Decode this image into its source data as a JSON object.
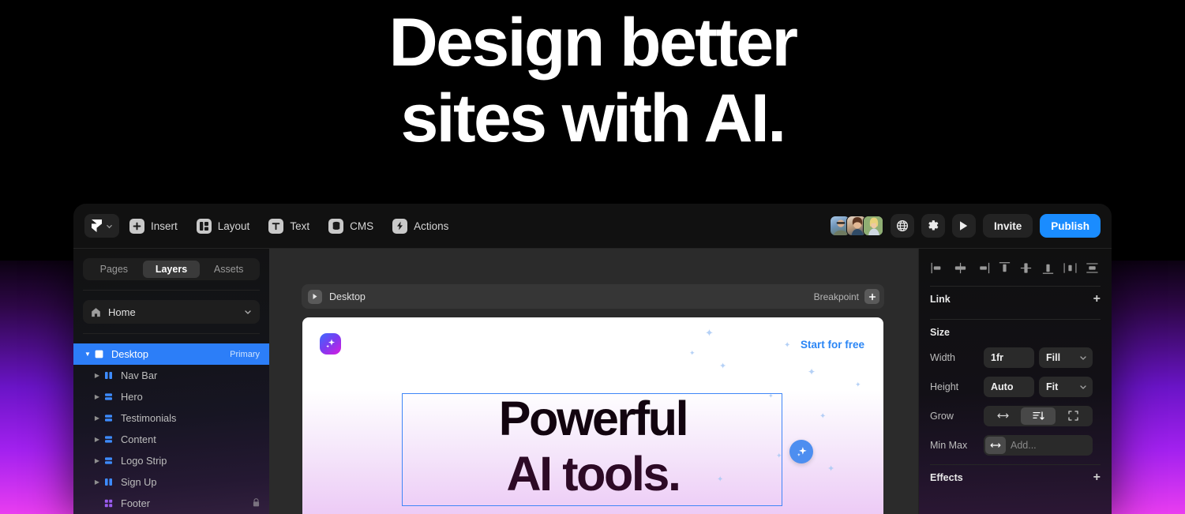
{
  "hero": {
    "line1": "Design better",
    "line2": "sites with AI."
  },
  "toolbar": {
    "logo_icon": "framer-logo-icon",
    "logo_chevron_icon": "chevron-down-icon",
    "items": [
      {
        "label": "Insert",
        "icon": "plus-square-icon"
      },
      {
        "label": "Layout",
        "icon": "layout-columns-icon"
      },
      {
        "label": "Text",
        "icon": "text-t-icon"
      },
      {
        "label": "CMS",
        "icon": "database-icon"
      },
      {
        "label": "Actions",
        "icon": "lightning-bolt-icon"
      }
    ],
    "avatars": [
      "avatar-1",
      "avatar-2",
      "avatar-3"
    ],
    "globe_icon": "globe-icon",
    "settings_icon": "gear-icon",
    "preview_icon": "play-icon",
    "invite_label": "Invite",
    "publish_label": "Publish",
    "publish_color": "#1a8cff"
  },
  "left_panel": {
    "tabs": [
      {
        "label": "Pages",
        "active": false
      },
      {
        "label": "Layers",
        "active": true
      },
      {
        "label": "Assets",
        "active": false
      }
    ],
    "page_selector": {
      "icon": "home-icon",
      "label": "Home",
      "chevron_icon": "chevron-down-icon"
    },
    "layers": [
      {
        "name": "Desktop",
        "icon": "frame-icon",
        "badge": "Primary",
        "selected": true,
        "expanded": true,
        "indent": 0,
        "locked": false,
        "icon_color": "#ffffff"
      },
      {
        "name": "Nav Bar",
        "icon": "stack-vertical-icon",
        "badge": "",
        "selected": false,
        "expanded": false,
        "indent": 1,
        "locked": false,
        "icon_color": "#3d8bfd"
      },
      {
        "name": "Hero",
        "icon": "stack-horizontal-icon",
        "badge": "",
        "selected": false,
        "expanded": false,
        "indent": 1,
        "locked": false,
        "icon_color": "#3d8bfd"
      },
      {
        "name": "Testimonials",
        "icon": "stack-horizontal-icon",
        "badge": "",
        "selected": false,
        "expanded": false,
        "indent": 1,
        "locked": false,
        "icon_color": "#3d8bfd"
      },
      {
        "name": "Content",
        "icon": "stack-horizontal-icon",
        "badge": "",
        "selected": false,
        "expanded": false,
        "indent": 1,
        "locked": false,
        "icon_color": "#3d8bfd"
      },
      {
        "name": "Logo Strip",
        "icon": "stack-horizontal-icon",
        "badge": "",
        "selected": false,
        "expanded": false,
        "indent": 1,
        "locked": false,
        "icon_color": "#3d8bfd"
      },
      {
        "name": "Sign Up",
        "icon": "stack-vertical-icon",
        "badge": "",
        "selected": false,
        "expanded": false,
        "indent": 1,
        "locked": false,
        "icon_color": "#3d8bfd"
      },
      {
        "name": "Footer",
        "icon": "grid-four-icon",
        "badge": "",
        "selected": false,
        "expanded": false,
        "indent": 1,
        "locked": true,
        "icon_color": "#9b5cf0"
      }
    ],
    "selected_color": "#2c7ef8"
  },
  "canvas": {
    "breakpoint_bar": {
      "play_icon": "play-icon",
      "label": "Desktop",
      "breakpoint_label": "Breakpoint",
      "add_icon": "plus-icon"
    },
    "artboard": {
      "ai_badge_icon": "sparkle-icon",
      "cta_label": "Start for free",
      "cta_color": "#2b86f5",
      "heading_line1": "Powerful",
      "heading_line2": "AI tools.",
      "selection_color": "#3f86f7",
      "ai_cursor_icon": "sparkle-icon"
    }
  },
  "right_panel": {
    "align_icons": [
      "align-left-icon",
      "align-horizontal-center-icon",
      "align-right-icon",
      "align-top-icon",
      "align-vertical-center-icon",
      "align-bottom-icon",
      "distribute-horizontal-icon",
      "distribute-vertical-icon"
    ],
    "link": {
      "title": "Link",
      "add_icon": "plus-icon"
    },
    "size": {
      "title": "Size",
      "width": {
        "label": "Width",
        "value": "1fr",
        "mode": "Fill"
      },
      "height": {
        "label": "Height",
        "value": "Auto",
        "mode": "Fit"
      },
      "grow": {
        "label": "Grow",
        "options": [
          "grow-horizontal-icon",
          "grow-stack-icon",
          "grow-expand-icon"
        ],
        "selected_index": 1
      },
      "min_max": {
        "label": "Min Max",
        "icon": "arrows-horizontal-icon",
        "placeholder": "Add..."
      }
    },
    "effects": {
      "title": "Effects",
      "add_icon": "plus-icon"
    }
  }
}
